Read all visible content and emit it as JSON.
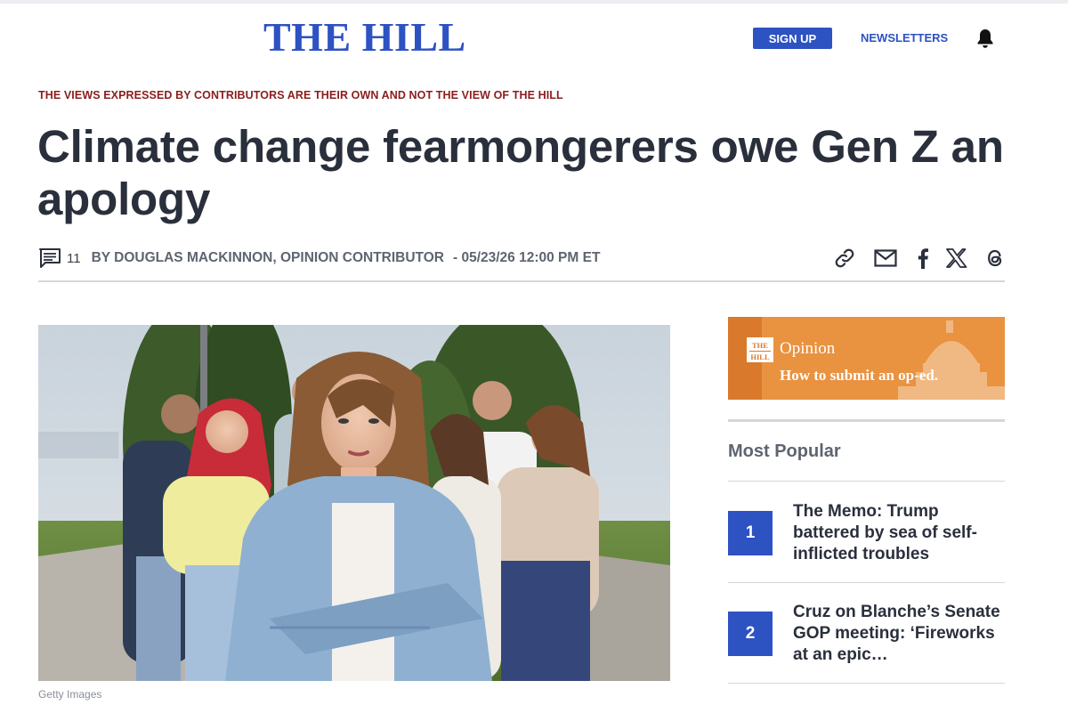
{
  "header": {
    "logo": "THE HILL",
    "signup_label": "SIGN UP",
    "newsletters_label": "NEWSLETTERS",
    "brand_color": "#2d52c2"
  },
  "article": {
    "disclaimer": "THE VIEWS EXPRESSED BY CONTRIBUTORS ARE THEIR OWN AND NOT THE VIEW OF THE HILL",
    "headline": "Climate change fearmongerers owe Gen Z an apology",
    "comment_count": "11",
    "author": "BY DOUGLAS MACKINNON, OPINION CONTRIBUTOR",
    "timestamp": "- 05/23/26 12:00 PM ET",
    "image_credit": "Getty Images"
  },
  "share_icons": [
    "link-icon",
    "email-icon",
    "facebook-icon",
    "x-icon",
    "threads-icon"
  ],
  "sidebar": {
    "ad": {
      "logo_top": "THE",
      "logo_bottom": "HILL",
      "label": "Opinion",
      "cta": "How to submit an op-ed."
    },
    "most_popular_title": "Most Popular",
    "popular": [
      {
        "rank": "1",
        "title": "The Memo: Trump battered by sea of self-inflicted troubles"
      },
      {
        "rank": "2",
        "title": "Cruz on Blanche’s Senate GOP meeting: ‘Fireworks at an epic…"
      }
    ]
  }
}
